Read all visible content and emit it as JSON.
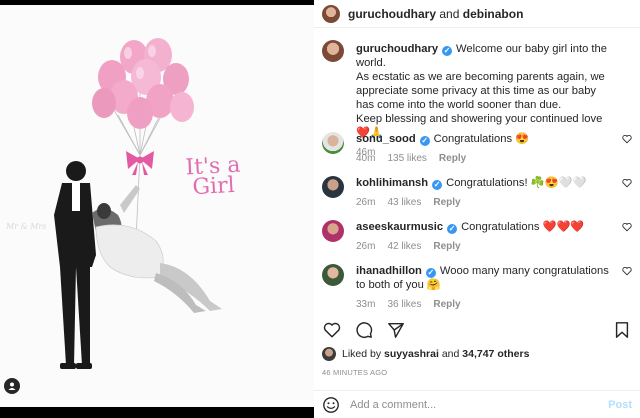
{
  "header": {
    "account_a": "guruchoudhary",
    "joiner": "and",
    "account_b": "debinabon"
  },
  "media": {
    "overlay_line1": "It's a",
    "overlay_line2": "Girl"
  },
  "caption": {
    "username": "guruchoudhary",
    "text": "Welcome our baby girl into the world.\nAs ecstatic as we are becoming parents again, we appreciate some privacy at this time as our baby has come into the world sooner than due.\nKeep blessing and showering your continued love ❤️🙏",
    "age": "46m"
  },
  "comments": [
    {
      "username": "sonu_sood",
      "verified": true,
      "text": "Congratulations 😍",
      "age": "40m",
      "likes": "135 likes",
      "reply": "Reply"
    },
    {
      "username": "kohlihimansh",
      "verified": true,
      "text": "Congratulations! ☘️😍🤍🤍",
      "age": "26m",
      "likes": "43 likes",
      "reply": "Reply"
    },
    {
      "username": "aseeskaurmusic",
      "verified": true,
      "text": "Congratulations ❤️❤️❤️",
      "age": "26m",
      "likes": "42 likes",
      "reply": "Reply"
    },
    {
      "username": "ihanadhillon",
      "verified": true,
      "text": "Wooo many many congratulations to both of you 🤗",
      "age": "33m",
      "likes": "36 likes",
      "reply": "Reply"
    }
  ],
  "likes": {
    "prefix": "Liked by",
    "user": "suyyashrai",
    "joiner": "and",
    "count": "34,747 others"
  },
  "timestamp": "46 MINUTES AGO",
  "add_comment": {
    "placeholder": "Add a comment...",
    "post_label": "Post"
  },
  "icons": {
    "like": "heart-icon",
    "comment": "comment-icon",
    "share": "share-icon",
    "save": "bookmark-icon",
    "emoji": "smiley-icon",
    "comment_like": "small-heart-icon"
  },
  "colors": {
    "accent": "#3897f0",
    "post_disabled": "#b2dffc",
    "pink": "#e26cb0"
  }
}
